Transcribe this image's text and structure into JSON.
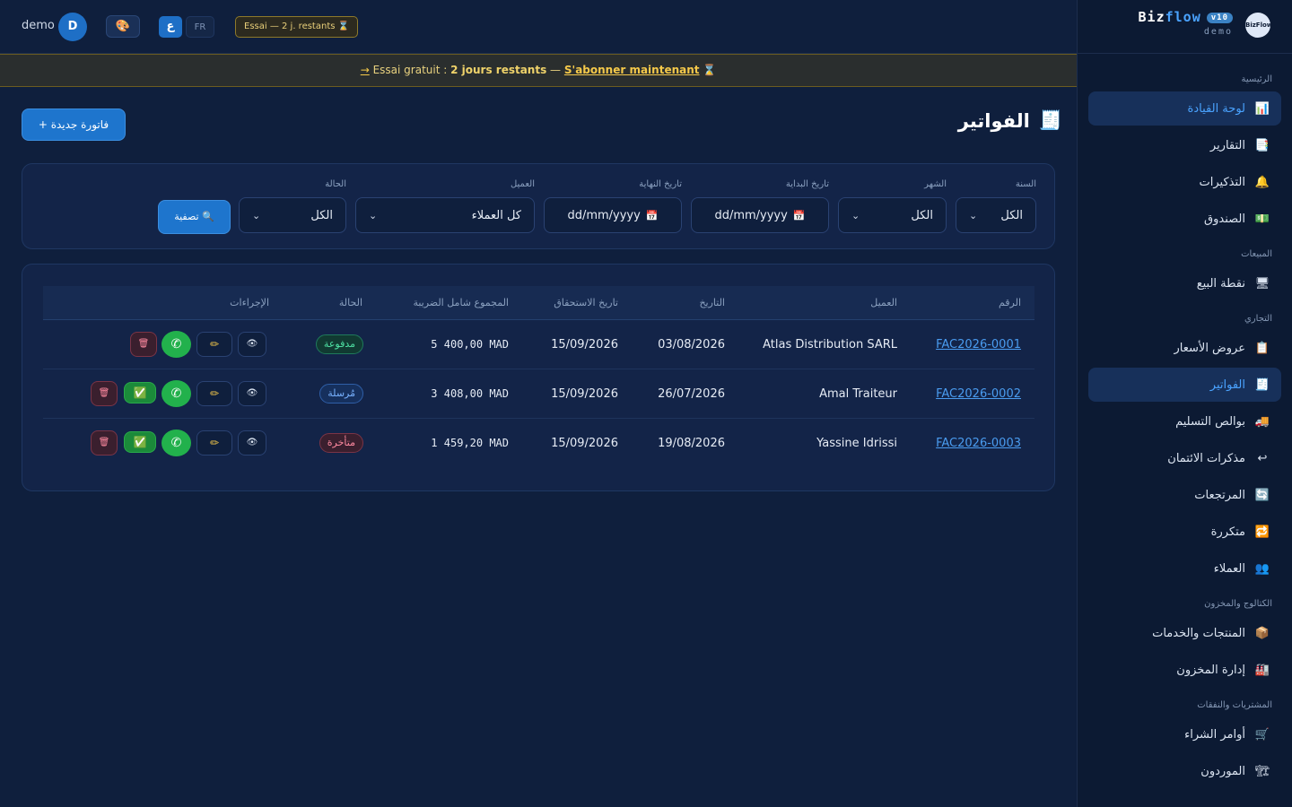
{
  "sidebar": {
    "brand": {
      "name_a": "Biz",
      "name_b": "flow",
      "version": "v10",
      "subtitle": "demo",
      "logo_text": "BizFlow"
    },
    "sections": {
      "main": "الرئيسية",
      "sales": "المبيعات",
      "commercial": "التجاري",
      "catalog": "الكتالوج والمخزون",
      "purchases": "المشتريات والنفقات"
    },
    "items": {
      "dashboard": {
        "label": "لوحة القيادة",
        "icon": "📊"
      },
      "reports": {
        "label": "التقارير",
        "icon": "📑"
      },
      "reminders": {
        "label": "التذكيرات",
        "icon": "🔔"
      },
      "cashbox": {
        "label": "الصندوق",
        "icon": "💵"
      },
      "pos": {
        "label": "نقطة البيع",
        "icon": "🖥"
      },
      "quotes": {
        "label": "عروض الأسعار",
        "icon": "📋"
      },
      "invoices": {
        "label": "الفواتير",
        "icon": "🧾"
      },
      "delivery": {
        "label": "بوالص التسليم",
        "icon": "🚚"
      },
      "credit_notes": {
        "label": "مذكرات الائتمان",
        "icon": "↩"
      },
      "returns": {
        "label": "المرتجعات",
        "icon": "🔄"
      },
      "recurring": {
        "label": "متكررة",
        "icon": "🔁"
      },
      "clients": {
        "label": "العملاء",
        "icon": "👥"
      },
      "products": {
        "label": "المنتجات والخدمات",
        "icon": "📦"
      },
      "stock": {
        "label": "إدارة المخزون",
        "icon": "🏭"
      },
      "purchase_orders": {
        "label": "أوامر الشراء",
        "icon": "🛒"
      },
      "suppliers": {
        "label": "الموردون",
        "icon": "🏗"
      }
    }
  },
  "topbar": {
    "user": "demo",
    "avatar": "D",
    "theme_icon": "🎨",
    "lang_ar": "ع",
    "lang_fr": "FR",
    "trial_badge": "Essai — 2 j. restants ⌛"
  },
  "banner": {
    "arrow": "→",
    "prefix": " Essai gratuit : ",
    "days": "2 jours restants",
    "sep": " — ",
    "link": "S'abonner maintenant",
    "suffix": " ⌛"
  },
  "page": {
    "title": "الفواتير",
    "title_icon": "🧾",
    "new_button": "+ فاتورة جديدة"
  },
  "filters": {
    "year": {
      "label": "السنة",
      "value": "الكل"
    },
    "month": {
      "label": "الشهر",
      "value": "الكل"
    },
    "start_date": {
      "label": "تاريخ البداية",
      "value": "dd/mm/yyyy"
    },
    "end_date": {
      "label": "تاريخ النهاية",
      "value": "dd/mm/yyyy"
    },
    "client": {
      "label": "العميل",
      "value": "كل العملاء"
    },
    "status": {
      "label": "الحالة",
      "value": "الكل"
    },
    "filter_button": "🔍 تصفية"
  },
  "table": {
    "columns": {
      "number": "الرقم",
      "client": "العميل",
      "date": "التاريخ",
      "due": "تاريخ الاستحقاق",
      "total": "المجموع شامل الضريبة",
      "status": "الحالة",
      "actions": "الإجراءات"
    },
    "rows": [
      {
        "number": "FAC2026-0001",
        "client": "Atlas Distribution SARL",
        "date": "03/08/2026",
        "due": "15/09/2026",
        "total": "5 400,00 MAD",
        "status": "مدفوعة"
      },
      {
        "number": "FAC2026-0002",
        "client": "Amal Traiteur",
        "date": "26/07/2026",
        "due": "15/09/2026",
        "total": "3 408,00 MAD",
        "status": "مُرسلة"
      },
      {
        "number": "FAC2026-0003",
        "client": "Yassine Idrissi",
        "date": "19/08/2026",
        "due": "15/09/2026",
        "total": "1 459,20 MAD",
        "status": "متأخرة"
      }
    ]
  },
  "icons": {
    "view": "👁",
    "edit": "✏",
    "whatsapp": "✆",
    "mark_paid": "✅",
    "delete": "🗑",
    "chevron": "⌄",
    "calendar": "📅"
  },
  "colors": {
    "accent": "#1e75cd",
    "link": "#4a9cf0",
    "paid": "#4ee0a3",
    "sent": "#78b2ff",
    "late": "#ff8aa0",
    "whatsapp": "#22b14c",
    "trial": "#f5c94a"
  }
}
